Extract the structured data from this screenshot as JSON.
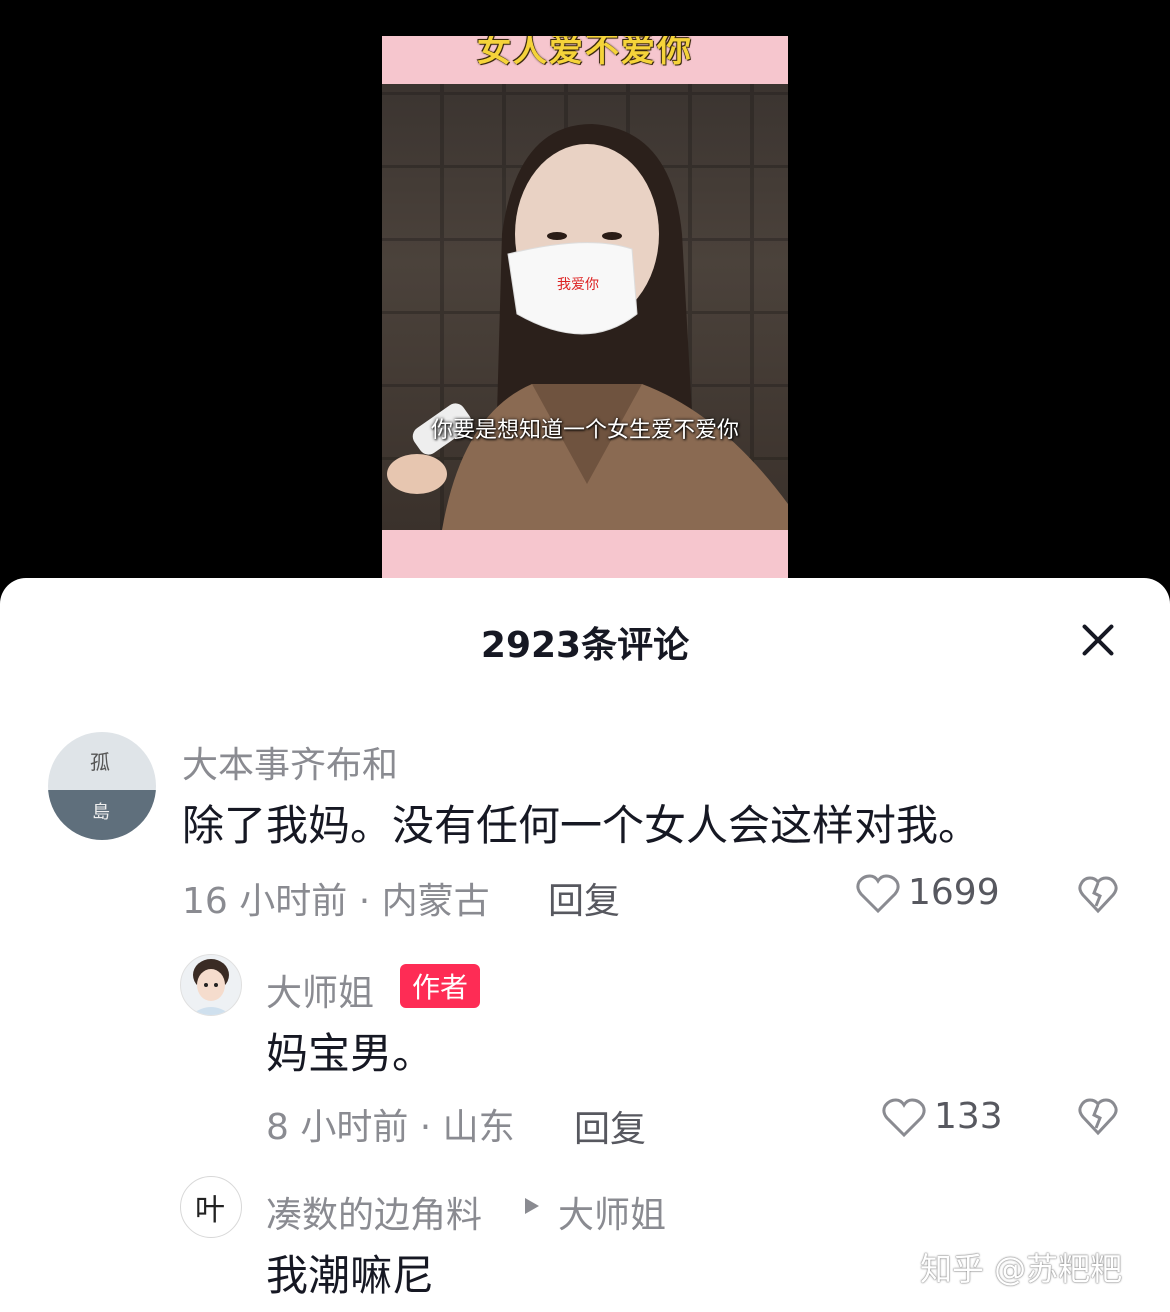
{
  "video": {
    "title": "女人爱不爱你",
    "subtitle": "你要是想知道一个女生爱不爱你"
  },
  "header": {
    "title": "2923条评论"
  },
  "comments": [
    {
      "username": "大本事齐布和",
      "avatar_text_1": "孤",
      "avatar_text_2": "島",
      "text": "除了我妈。没有任何一个女人会这样对我。",
      "meta": "16 小时前 · 内蒙古",
      "reply_label": "回复",
      "likes": "1699"
    },
    {
      "username": "大师姐",
      "badge": "作者",
      "text": "妈宝男。",
      "meta": "8 小时前 · 山东",
      "reply_label": "回复",
      "likes": "133"
    },
    {
      "username": "凑数的边角料",
      "reply_to": "大师姐",
      "avatar_text": "叶",
      "text": "我潮嘛尼"
    }
  ],
  "watermark": "知乎 @苏粑粑",
  "colors": {
    "accent": "#fe2c55",
    "muted": "#8a8b91",
    "text": "#161823"
  }
}
